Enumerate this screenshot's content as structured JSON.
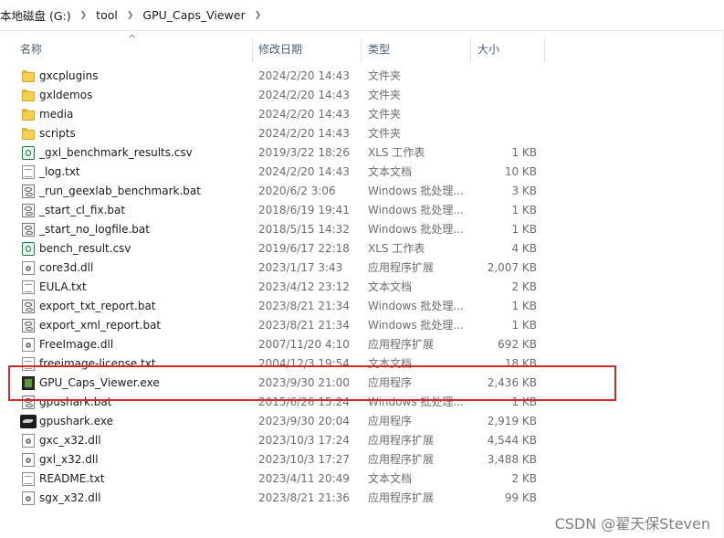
{
  "breadcrumb": [
    "本地磁盘 (G:)",
    "tool",
    "GPU_Caps_Viewer"
  ],
  "columns": {
    "name": "名称",
    "date": "修改日期",
    "type": "类型",
    "size": "大小"
  },
  "files": [
    {
      "name": "gxcplugins",
      "date": "2024/2/20 14:43",
      "type": "文件夹",
      "size": "",
      "icon": "folder-icon"
    },
    {
      "name": "gxldemos",
      "date": "2024/2/20 14:43",
      "type": "文件夹",
      "size": "",
      "icon": "folder-icon"
    },
    {
      "name": "media",
      "date": "2024/2/20 14:43",
      "type": "文件夹",
      "size": "",
      "icon": "folder-icon"
    },
    {
      "name": "scripts",
      "date": "2024/2/20 14:43",
      "type": "文件夹",
      "size": "",
      "icon": "folder-icon"
    },
    {
      "name": "_gxl_benchmark_results.csv",
      "date": "2019/3/22 18:26",
      "type": "XLS 工作表",
      "size": "1 KB",
      "icon": "spreadsheet-icon"
    },
    {
      "name": "_log.txt",
      "date": "2024/2/20 14:43",
      "type": "文本文档",
      "size": "10 KB",
      "icon": "text-file-icon"
    },
    {
      "name": "_run_geexlab_benchmark.bat",
      "date": "2020/6/2 3:06",
      "type": "Windows 批处理...",
      "size": "3 KB",
      "icon": "batch-file-icon"
    },
    {
      "name": "_start_cl_fix.bat",
      "date": "2018/6/19 19:41",
      "type": "Windows 批处理...",
      "size": "1 KB",
      "icon": "batch-file-icon"
    },
    {
      "name": "_start_no_logfile.bat",
      "date": "2018/5/15 14:32",
      "type": "Windows 批处理...",
      "size": "1 KB",
      "icon": "batch-file-icon"
    },
    {
      "name": "bench_result.csv",
      "date": "2019/6/17 22:18",
      "type": "XLS 工作表",
      "size": "4 KB",
      "icon": "spreadsheet-icon"
    },
    {
      "name": "core3d.dll",
      "date": "2023/1/17 3:43",
      "type": "应用程序扩展",
      "size": "2,007 KB",
      "icon": "dll-file-icon"
    },
    {
      "name": "EULA.txt",
      "date": "2023/4/12 23:12",
      "type": "文本文档",
      "size": "2 KB",
      "icon": "text-file-icon"
    },
    {
      "name": "export_txt_report.bat",
      "date": "2023/8/21 21:34",
      "type": "Windows 批处理...",
      "size": "1 KB",
      "icon": "batch-file-icon"
    },
    {
      "name": "export_xml_report.bat",
      "date": "2023/8/21 21:34",
      "type": "Windows 批处理...",
      "size": "1 KB",
      "icon": "batch-file-icon"
    },
    {
      "name": "FreeImage.dll",
      "date": "2007/11/20 4:10",
      "type": "应用程序扩展",
      "size": "692 KB",
      "icon": "dll-file-icon"
    },
    {
      "name": "freeimage-license.txt",
      "date": "2004/12/3 19:54",
      "type": "文本文档",
      "size": "18 KB",
      "icon": "text-file-icon"
    },
    {
      "name": "GPU_Caps_Viewer.exe",
      "date": "2023/9/30 21:00",
      "type": "应用程序",
      "size": "2,436 KB",
      "icon": "gpu-caps-app-icon"
    },
    {
      "name": "gpushark.bat",
      "date": "2015/6/26 15:24",
      "type": "Windows 批处理...",
      "size": "1 KB",
      "icon": "batch-file-icon"
    },
    {
      "name": "gpushark.exe",
      "date": "2023/9/30 20:04",
      "type": "应用程序",
      "size": "2,919 KB",
      "icon": "gpushark-app-icon"
    },
    {
      "name": "gxc_x32.dll",
      "date": "2023/10/3 17:24",
      "type": "应用程序扩展",
      "size": "4,544 KB",
      "icon": "dll-file-icon"
    },
    {
      "name": "gxl_x32.dll",
      "date": "2023/10/3 17:27",
      "type": "应用程序扩展",
      "size": "3,488 KB",
      "icon": "dll-file-icon"
    },
    {
      "name": "README.txt",
      "date": "2023/4/11 20:49",
      "type": "文本文档",
      "size": "2 KB",
      "icon": "text-file-icon"
    },
    {
      "name": "sgx_x32.dll",
      "date": "2023/8/21 21:36",
      "type": "应用程序扩展",
      "size": "99 KB",
      "icon": "dll-file-icon"
    }
  ],
  "highlight_color": "#d32a2a",
  "watermark": "CSDN @翟天保Steven"
}
